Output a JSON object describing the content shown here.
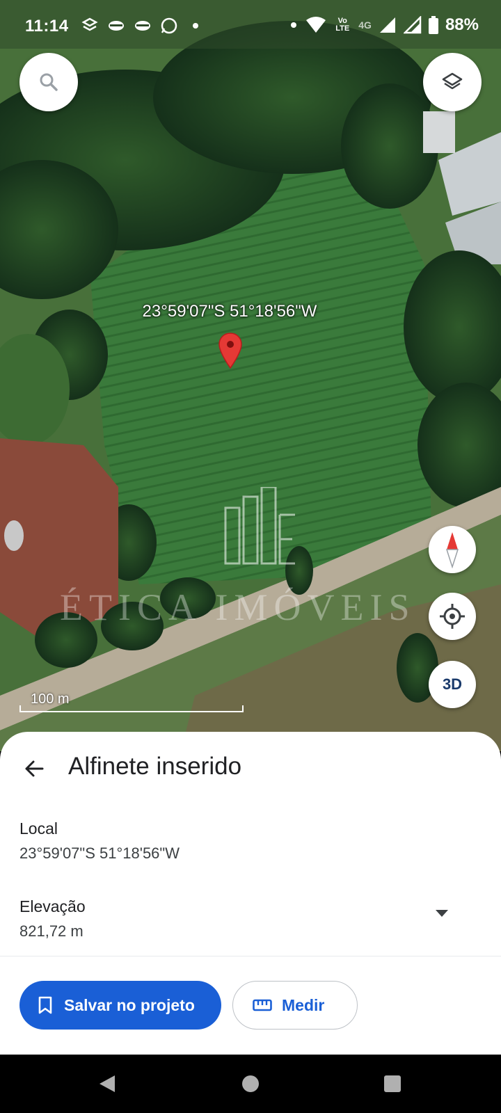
{
  "status_bar": {
    "time": "11:14",
    "battery": "88%",
    "network": "4G",
    "volte": "Vo LTE"
  },
  "map": {
    "pin_coordinates_label": "23°59'07\"S 51°18'56\"W",
    "scale_label": "100 m",
    "watermark_text": "ÉTICA IMÓVEIS",
    "three_d_label": "3D",
    "pin_color": "#e53935"
  },
  "sheet": {
    "title": "Alfinete inserido",
    "local_label": "Local",
    "local_value": "23°59'07\"S 51°18'56\"W",
    "elevation_label": "Elevação",
    "elevation_value": "821,72 m",
    "save_button_label": "Salvar no projeto",
    "measure_button_label": "Medir",
    "accent_color": "#1a5fd6"
  },
  "icons": {
    "search": "search-icon",
    "layers": "layers-icon",
    "compass": "compass-icon",
    "locate": "my-location-icon",
    "back": "arrow-back-icon",
    "bookmark": "bookmark-icon",
    "ruler": "ruler-icon",
    "dropdown": "caret-down-icon"
  }
}
